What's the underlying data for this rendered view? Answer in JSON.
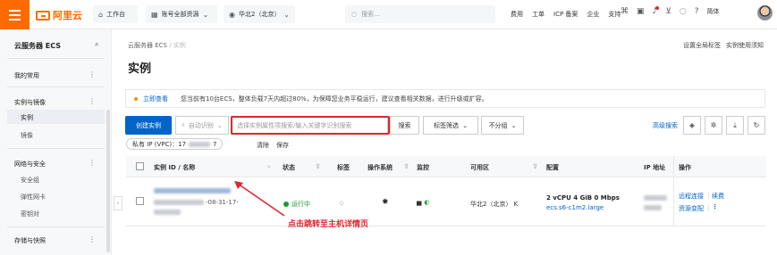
{
  "topbar": {
    "logo_text": "阿里云",
    "workbench": "工作台",
    "account_resources": "账号全部资源",
    "region": "华北2（北京）",
    "search_placeholder": "搜索...",
    "links": [
      "费用",
      "工单",
      "ICP 备案",
      "企业",
      "支持"
    ],
    "language": "简体",
    "brand_color": "#ff6a00"
  },
  "sidebar": {
    "title": "云服务器 ECS",
    "sections": [
      {
        "label": "我的常用",
        "items": []
      },
      {
        "label": "实例与镜像",
        "items": [
          "实例",
          "镜像"
        ]
      },
      {
        "label": "网络与安全",
        "items": [
          "安全组",
          "弹性网卡",
          "密钥对"
        ]
      },
      {
        "label": "存储与快照",
        "items": []
      }
    ],
    "active_item": "实例"
  },
  "main": {
    "breadcrumb": [
      "云服务器 ECS",
      "实例"
    ],
    "breadcrumb_sep": "/",
    "top_right_links": [
      "设置全局标签",
      "实例使用须知"
    ],
    "page_title": "实例",
    "notice": {
      "link": "立即查看",
      "text": "您当前有10台ECS，整体负载7天内超过80%，为保障您业务平稳运行，建议查看相关数据，进行升级或扩容。"
    },
    "toolbar": {
      "create_btn": "创建实例",
      "auto_identify": "自动识别",
      "search_placeholder": "选择实例属性项搜索/输入关键字识别搜索",
      "search_btn": "搜索",
      "tag_filter": "标签筛选",
      "group": "不分组",
      "advanced": "高级搜索"
    },
    "filter_tag": {
      "label": "私有 IP (VPC)：17",
      "suffix": "7",
      "clear": "清除",
      "save": "保存"
    },
    "table": {
      "headers": [
        "实例 ID / 名称",
        "状态",
        "标签",
        "操作系统",
        "监控",
        "可用区",
        "配置",
        "IP 地址",
        "操作"
      ],
      "row": {
        "id_suffix": "-08-31-17-",
        "status": "运行中",
        "zone": "华北2（北京） K",
        "config_line1": "2 vCPU  4 GiB  0 Mbps",
        "config_line2": "ecs.s6-c1m2.large",
        "ops": [
          "远程连接",
          "续费",
          "资源变配"
        ]
      }
    },
    "annotation": "点击跳转至主机详情页",
    "accent_color": "#0064c8",
    "annotation_color": "#e0262f"
  }
}
